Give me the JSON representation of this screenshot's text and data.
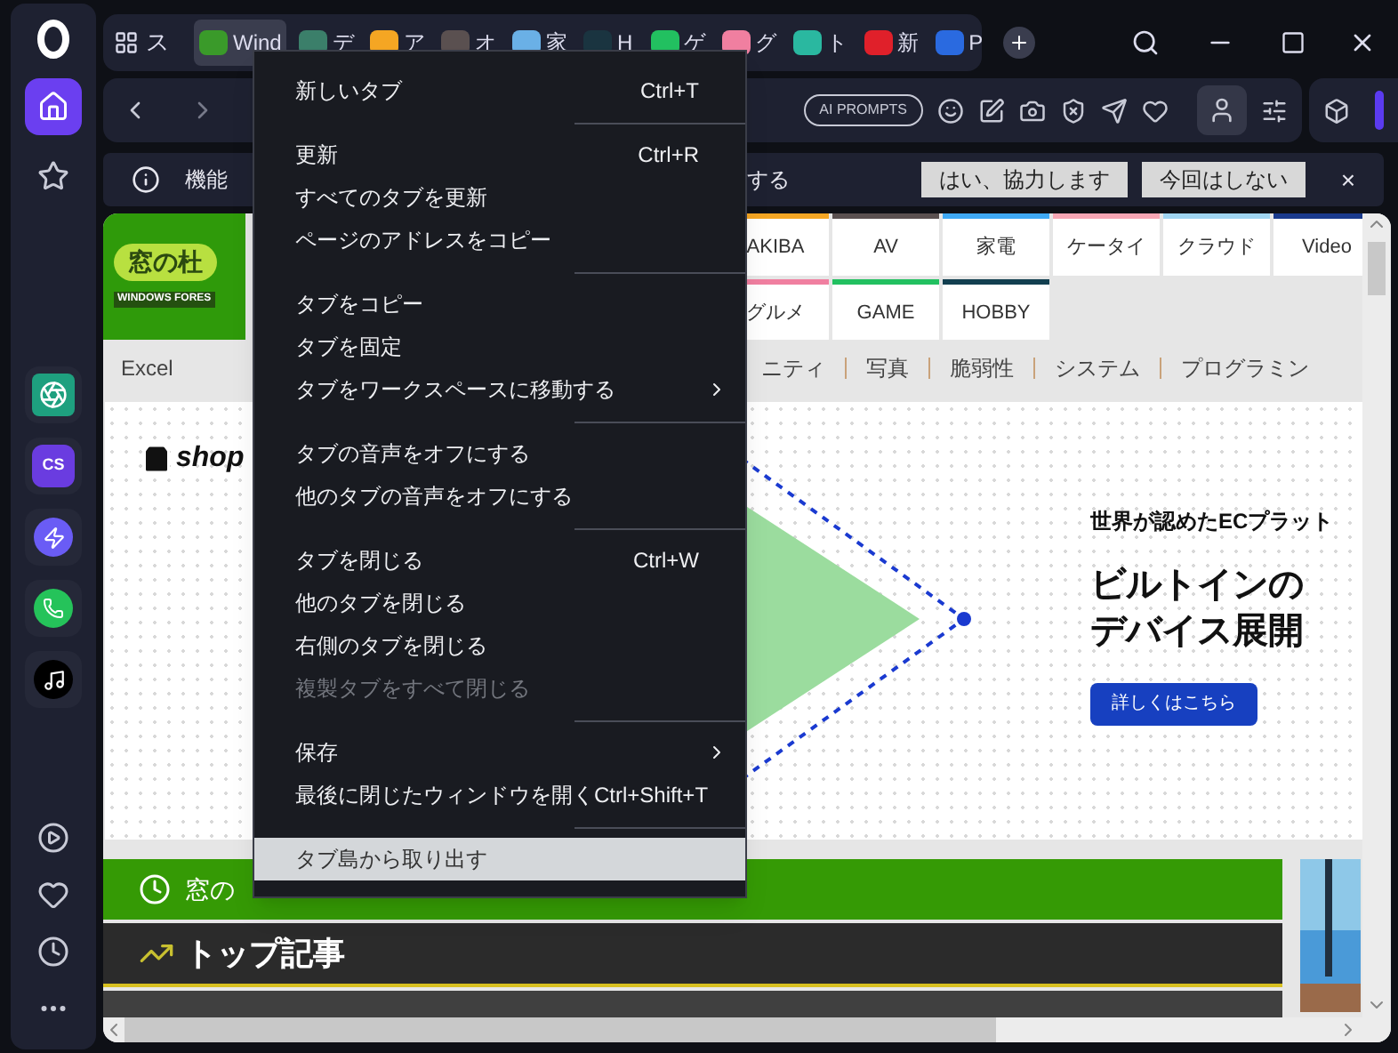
{
  "sidebar": {
    "items": [
      {
        "kind": "home",
        "selected": true
      },
      {
        "kind": "star",
        "selected": false
      }
    ],
    "apps": [
      {
        "kind": "chatgpt"
      },
      {
        "kind": "cs",
        "label": "CS"
      },
      {
        "kind": "messenger"
      },
      {
        "kind": "whatsapp"
      },
      {
        "kind": "tiktok"
      }
    ],
    "bottom": [
      {
        "kind": "player"
      },
      {
        "kind": "heart"
      },
      {
        "kind": "history"
      },
      {
        "kind": "more"
      }
    ]
  },
  "tab_bar": {
    "workspace": "ス",
    "tabs": [
      {
        "label": "Wind",
        "color": "#3a9a2a",
        "selected": true
      },
      {
        "label": "デ",
        "color": "#3b7f6a",
        "selected": false
      },
      {
        "label": "ア",
        "color": "#f5a623",
        "selected": false
      },
      {
        "label": "オ",
        "color": "#5a5050",
        "selected": false
      },
      {
        "label": "家",
        "color": "#6ab0e6",
        "selected": false
      },
      {
        "label": "H",
        "color": "#1a3440",
        "selected": false
      },
      {
        "label": "ゲ",
        "color": "#22c060",
        "selected": false
      },
      {
        "label": "グ",
        "color": "#f07fa0",
        "selected": false
      },
      {
        "label": "ト",
        "color": "#2ab8a0",
        "selected": false
      },
      {
        "label": "新",
        "color": "#e0202a",
        "selected": false
      },
      {
        "label": "P",
        "color": "#2a6ae0",
        "selected": false
      }
    ]
  },
  "address_bar": {
    "ai_prompts": "AI PROMPTS"
  },
  "info_bar": {
    "text_start": "機能",
    "text_end": "する",
    "buttons": [
      "はい、協力します",
      "今回はしない"
    ],
    "close": "×"
  },
  "page": {
    "logo": {
      "title": "窓の杜",
      "subtitle": "WINDOWS FORES"
    },
    "categories": [
      [
        {
          "label": "AKIBA",
          "color": "#f5a623"
        },
        {
          "label": "AV",
          "color": "#5a5050"
        },
        {
          "label": "家電",
          "color": "#3fa9f5"
        },
        {
          "label": "ケータイ",
          "color": "#f7a6b4"
        },
        {
          "label": "クラウド",
          "color": "#9fd4f0"
        },
        {
          "label": "Video",
          "color": "#1a3a8c"
        }
      ],
      [
        {
          "label": "グルメ",
          "color": "#f07fa0"
        },
        {
          "label": "GAME",
          "color": "#22c060"
        },
        {
          "label": "HOBBY",
          "color": "#123f50"
        }
      ]
    ],
    "nav_left": [
      "Excel"
    ],
    "nav_right": [
      "ニティ",
      "写真",
      "脆弱性",
      "システム",
      "プログラミン"
    ],
    "ad": {
      "brand": "shop",
      "tagline": "世界が認めたECプラット",
      "headline": [
        "ビルトインの",
        "デバイス展開"
      ],
      "button": "詳しくはこちら"
    },
    "update_bar": "窓の",
    "section_title": "トップ記事"
  },
  "context_menu": {
    "items": [
      {
        "kind": "item",
        "label": "新しいタブ",
        "shortcut": "Ctrl+T"
      },
      {
        "kind": "separator"
      },
      {
        "kind": "item",
        "label": "更新",
        "shortcut": "Ctrl+R"
      },
      {
        "kind": "item",
        "label": "すべてのタブを更新"
      },
      {
        "kind": "item",
        "label": "ページのアドレスをコピー"
      },
      {
        "kind": "separator"
      },
      {
        "kind": "item",
        "label": "タブをコピー"
      },
      {
        "kind": "item",
        "label": "タブを固定"
      },
      {
        "kind": "submenu",
        "label": "タブをワークスペースに移動する"
      },
      {
        "kind": "separator"
      },
      {
        "kind": "item",
        "label": "タブの音声をオフにする"
      },
      {
        "kind": "item",
        "label": "他のタブの音声をオフにする"
      },
      {
        "kind": "separator"
      },
      {
        "kind": "item",
        "label": "タブを閉じる",
        "shortcut": "Ctrl+W"
      },
      {
        "kind": "item",
        "label": "他のタブを閉じる"
      },
      {
        "kind": "item",
        "label": "右側のタブを閉じる"
      },
      {
        "kind": "item",
        "label": "複製タブをすべて閉じる",
        "disabled": true
      },
      {
        "kind": "separator"
      },
      {
        "kind": "submenu",
        "label": "保存"
      },
      {
        "kind": "item",
        "label": "最後に閉じたウィンドウを開く",
        "shortcut": "Ctrl+Shift+T"
      },
      {
        "kind": "separator"
      },
      {
        "kind": "item",
        "label": "タブ島から取り出す",
        "selected": true
      }
    ]
  }
}
